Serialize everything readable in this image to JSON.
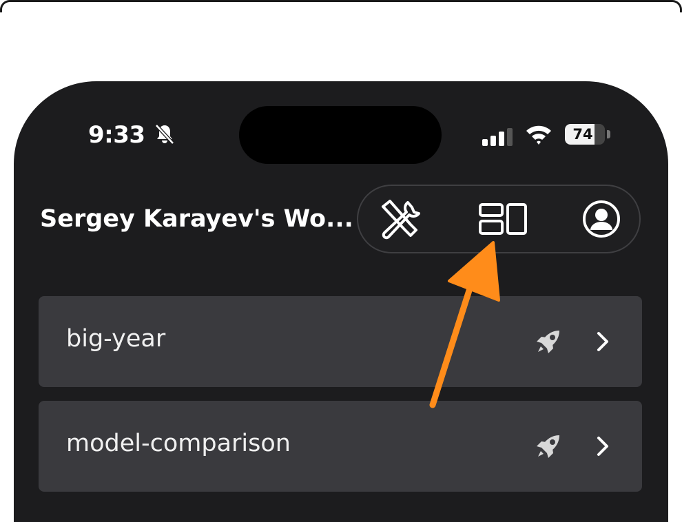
{
  "status_bar": {
    "time": "9:33",
    "battery": "74",
    "battery_level": 0.74
  },
  "header": {
    "workspace_title": "Sergey Karayev's Wo..."
  },
  "toolbar": {
    "icons": [
      "tools-icon",
      "layout-icon",
      "profile-icon"
    ]
  },
  "projects": [
    {
      "name": "big-year"
    },
    {
      "name": "model-comparison"
    }
  ],
  "annotation": {
    "arrow_color": "#ff8c1a"
  },
  "colors": {
    "background": "#1c1c1e",
    "row": "#3a3a3e",
    "text": "#f0f0f0"
  }
}
